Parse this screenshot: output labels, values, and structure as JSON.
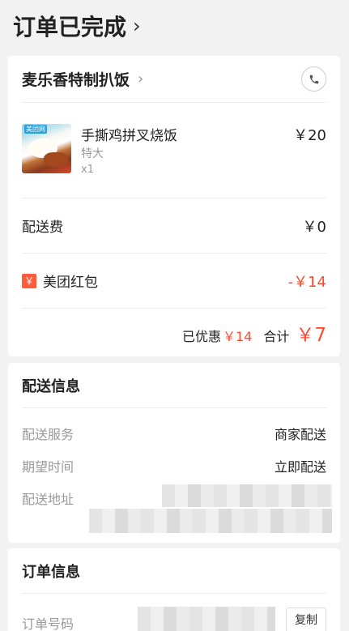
{
  "header": {
    "status_title": "订单已完成",
    "chevron": "›"
  },
  "shop": {
    "name": "麦乐香特制扒饭",
    "chevron": "›",
    "phone_icon": "phone-icon"
  },
  "item": {
    "brand_tag": "美团网",
    "name": "手撕鸡拼叉烧饭",
    "spec": "特大",
    "quantity": "x1",
    "price": "￥20"
  },
  "delivery_fee": {
    "label": "配送费",
    "amount": "￥0"
  },
  "red_packet": {
    "icon": "￥",
    "label": "美团红包",
    "amount": "-￥14"
  },
  "summary": {
    "discount_label": "已优惠",
    "discount_amount": "￥14",
    "total_label": "合计",
    "total_amount": "￥7"
  },
  "delivery_info": {
    "title": "配送信息",
    "service_label": "配送服务",
    "service_value": "商家配送",
    "time_label": "期望时间",
    "time_value": "立即配送",
    "address_label": "配送地址"
  },
  "order_info": {
    "title": "订单信息",
    "number_label": "订单号码",
    "copy_label": "复制"
  },
  "colors": {
    "accent_red": "#ff4a2f",
    "background": "#f2f2f2"
  }
}
